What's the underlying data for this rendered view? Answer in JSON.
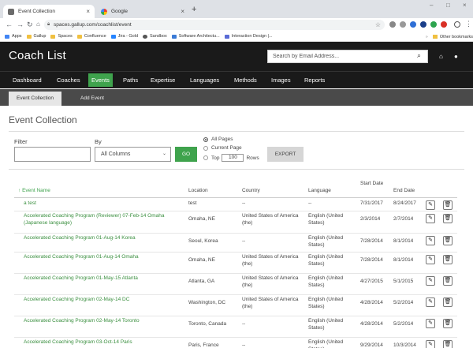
{
  "browser": {
    "tabs": [
      {
        "title": "Event Collection",
        "active": true
      },
      {
        "title": "Google",
        "active": false
      }
    ],
    "url": "spaces.gallup.com/coachlist/event",
    "bookmarks": [
      "Apps",
      "Gallup",
      "Spaces",
      "Confluence",
      "Jira - Gold",
      "Sandbox",
      "Software Architectu...",
      "Interaction Design |..."
    ],
    "other_bookmarks": "Other bookmarks"
  },
  "header": {
    "title": "Coach List",
    "search_placeholder": "Search by Email Address..."
  },
  "nav": {
    "items": [
      "Dashboard",
      "Coaches",
      "Events",
      "Paths",
      "Expertise",
      "Languages",
      "Methods",
      "Images",
      "Reports"
    ],
    "active": "Events"
  },
  "subnav": {
    "items": [
      "Event Collection",
      "Add Event"
    ],
    "active": "Event Collection"
  },
  "page": {
    "title": "Event Collection"
  },
  "filters": {
    "filter_label": "Filter",
    "filter_value": "",
    "by_label": "By",
    "by_selected": "All Columns",
    "go_label": "GO",
    "scope_options": [
      "All Pages",
      "Current Page"
    ],
    "scope_selected": "All Pages",
    "top_label": "Top",
    "top_value": "100",
    "rows_label": "Rows",
    "export_label": "EXPORT"
  },
  "table": {
    "columns": {
      "event_name": "Event Name",
      "location": "Location",
      "country": "Country",
      "language": "Language",
      "start_date": "Start Date",
      "end_date": "End Date"
    },
    "sort_column": "Event Name",
    "rows": [
      {
        "name": "a test",
        "location": "test",
        "country": "--",
        "language": "--",
        "start": "7/31/2017",
        "end": "8/24/2017"
      },
      {
        "name": "Accelerated Coaching Program (Reviewer) 07-Feb-14 Omaha (Japanese language)",
        "location": "Omaha, NE",
        "country": "United States of America (the)",
        "language": "English (United States)",
        "start": "2/3/2014",
        "end": "2/7/2014"
      },
      {
        "name": "Accelerated Coaching Program 01-Aug-14 Korea",
        "location": "Seoul, Korea",
        "country": "--",
        "language": "English (United States)",
        "start": "7/28/2014",
        "end": "8/1/2014"
      },
      {
        "name": "Accelerated Coaching Program 01-Aug-14 Omaha",
        "location": "Omaha, NE",
        "country": "United States of America (the)",
        "language": "English (United States)",
        "start": "7/28/2014",
        "end": "8/1/2014"
      },
      {
        "name": "Accelerated Coaching Program 01-May-15 Atlanta",
        "location": "Atlanta, GA",
        "country": "United States of America (the)",
        "language": "English (United States)",
        "start": "4/27/2015",
        "end": "5/1/2015"
      },
      {
        "name": "Accelerated Coaching Program 02-May-14 DC",
        "location": "Washington, DC",
        "country": "United States of America (the)",
        "language": "English (United States)",
        "start": "4/28/2014",
        "end": "5/2/2014"
      },
      {
        "name": "Accelerated Coaching Program 02-May-14 Toronto",
        "location": "Toronto, Canada",
        "country": "--",
        "language": "English (United States)",
        "start": "4/28/2014",
        "end": "5/2/2014"
      },
      {
        "name": "Accelerated Coaching Program 03-Oct-14 Paris",
        "location": "Paris, France",
        "country": "--",
        "language": "English (United States)",
        "start": "9/29/2014",
        "end": "10/3/2014"
      }
    ]
  }
}
